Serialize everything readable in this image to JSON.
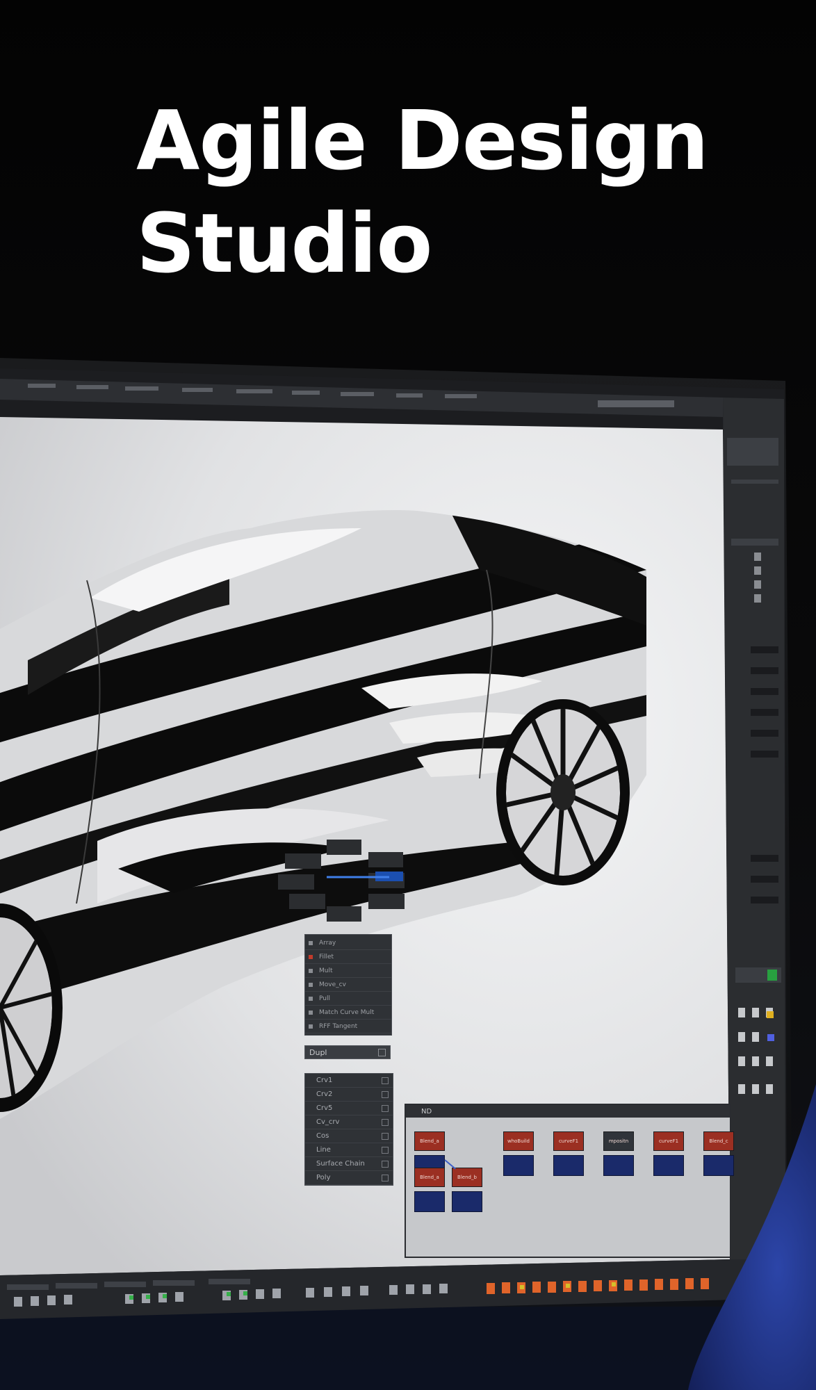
{
  "headline": {
    "line1": "Agile Design",
    "line2": "Studio"
  },
  "colors": {
    "page_background": "#050505",
    "headline": "#ffffff",
    "ui_panel": "#2b2d30",
    "viewport": "#e4e5e7",
    "node_red": "#9b2f22",
    "node_blue": "#1a2a6a",
    "sleeve": "#1f3280"
  },
  "menus": {
    "history_items": [
      "Array",
      "Fillet",
      "Mult",
      "Move_cv",
      "Pull",
      "Match Curve Mult",
      "RFF Tangent"
    ],
    "duplicate_label": "Dupl",
    "curve_items": [
      "Crv1",
      "Crv2",
      "Crv5",
      "Cv_crv",
      "Cos",
      "Line",
      "Surface Chain",
      "Poly"
    ]
  },
  "node_editor": {
    "title": "ND",
    "nodes": [
      "Blend_a",
      "Blend_a",
      "Blend_b",
      "whoBuild",
      "curveF1",
      "mpositn",
      "curveF1",
      "Blend_c"
    ]
  },
  "icons": {
    "toolbar": "tool-icon",
    "shelf": "shelf-tool-icon",
    "swatch": "material-swatch-icon",
    "checkbox": "checkbox-icon",
    "expand": "expand-icon"
  }
}
